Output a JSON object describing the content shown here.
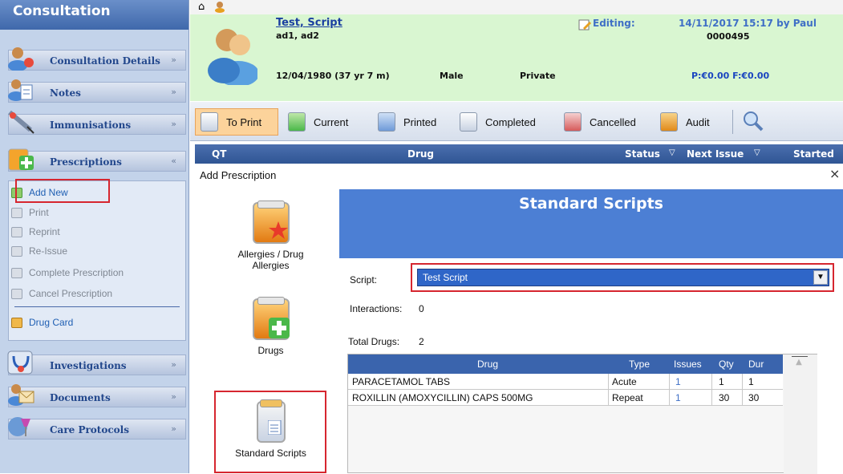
{
  "sidebar": {
    "title": "Consultation",
    "sections": {
      "consultation_details": "Consultation Details",
      "notes": "Notes",
      "immunisations": "Immunisations",
      "prescriptions": "Prescriptions",
      "investigations": "Investigations",
      "documents": "Documents",
      "care_protocols": "Care Protocols"
    },
    "prescription_items": {
      "add_new": "Add New",
      "print": "Print",
      "reprint": "Reprint",
      "reissue": "Re-Issue",
      "complete": "Complete Prescription",
      "cancel": "Cancel Prescription",
      "drug_card": "Drug Card"
    },
    "chevron_collapsed": "»",
    "chevron_expanded": "«"
  },
  "patient": {
    "name": "Test, Script",
    "address": "ad1, ad2",
    "dob": "12/04/1980 (37 yr 7 m)",
    "sex": "Male",
    "type": "Private",
    "editing_label": "Editing:",
    "editing_info": "14/11/2017 15:17 by Paul",
    "id": "0000495",
    "balance": "P:€0.00 F:€0.00"
  },
  "toolbar": {
    "to_print": "To Print",
    "current": "Current",
    "printed": "Printed",
    "completed": "Completed",
    "cancelled": "Cancelled",
    "audit": "Audit"
  },
  "grid": {
    "qt": "QT",
    "drug": "Drug",
    "status": "Status",
    "next_issue": "Next Issue",
    "started": "Started",
    "filter_glyph": "▽"
  },
  "dialog": {
    "title": "Add Prescription",
    "close": "×",
    "options": {
      "allergies": "Allergies / Drug Allergies",
      "drugs": "Drugs",
      "standard_scripts": "Standard Scripts"
    },
    "banner_title": "Standard Scripts",
    "script_label": "Script:",
    "script_value": "Test Script",
    "dropdown_glyph": "▼",
    "interactions_label": "Interactions:",
    "interactions_value": "0",
    "total_drugs_label": "Total Drugs:",
    "total_drugs_value": "2",
    "table": {
      "headers": {
        "drug": "Drug",
        "type": "Type",
        "issues": "Issues",
        "qty": "Qty",
        "dur": "Dur"
      },
      "rows": [
        {
          "drug": "PARACETAMOL TABS",
          "type": "Acute",
          "issues": "1",
          "qty": "1",
          "dur": "1"
        },
        {
          "drug": "ROXILLIN (AMOXYCILLIN) CAPS 500MG",
          "type": "Repeat",
          "issues": "1",
          "qty": "30",
          "dur": "30"
        }
      ]
    },
    "scroll_up_glyph": "▲"
  },
  "colors": {
    "sidebar_bg": "#c3d3ea",
    "header_green": "#d9f6d1",
    "banner_blue": "#4c7fd4",
    "highlight_red": "#d6262f",
    "toprint_orange": "#fcd39b"
  }
}
